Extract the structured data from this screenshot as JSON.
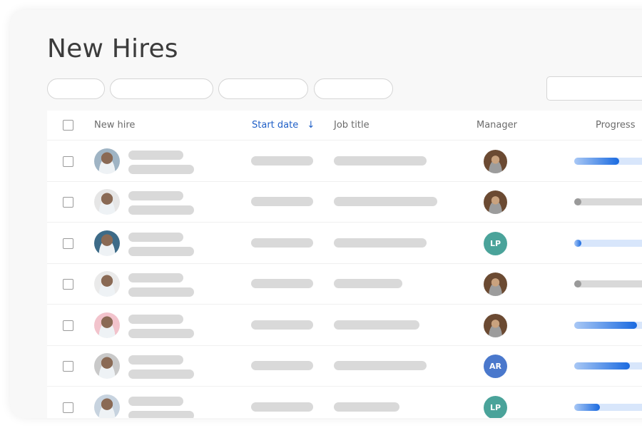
{
  "page": {
    "title": "New Hires"
  },
  "filters": {
    "chip_count": 4,
    "search_placeholder": ""
  },
  "table": {
    "columns": [
      {
        "key": "new_hire",
        "label": "New hire"
      },
      {
        "key": "start_date",
        "label": "Start date",
        "sorted": "desc",
        "sort_icon": "arrow-down-icon"
      },
      {
        "key": "job_title",
        "label": "Job title"
      },
      {
        "key": "manager",
        "label": "Manager"
      },
      {
        "key": "progress",
        "label": "Progress"
      }
    ],
    "rows": [
      {
        "avatar": "photo-man-light-shirt",
        "avatar_bg": "#9fb4c4",
        "manager": {
          "type": "photo",
          "initials": "",
          "color": "#6b4a32"
        },
        "progress": 0.45,
        "status": "active"
      },
      {
        "avatar": "photo-man-smiling",
        "avatar_bg": "#e6e6e6",
        "manager": {
          "type": "photo",
          "initials": "",
          "color": "#6b4a32"
        },
        "progress": 0,
        "status": "not-started"
      },
      {
        "avatar": "photo-woman-blue-bg",
        "avatar_bg": "#3d6b88",
        "manager": {
          "type": "initials",
          "initials": "LP",
          "color": "#4aa39a"
        },
        "progress": 0.03,
        "status": "active"
      },
      {
        "avatar": "photo-woman-dark-hair",
        "avatar_bg": "#eaeaea",
        "manager": {
          "type": "photo",
          "initials": "",
          "color": "#6b4a32"
        },
        "progress": 0,
        "status": "not-started"
      },
      {
        "avatar": "photo-woman-pink-bg",
        "avatar_bg": "#f2c3cc",
        "manager": {
          "type": "photo",
          "initials": "",
          "color": "#6b4a32"
        },
        "progress": 0.63,
        "status": "active"
      },
      {
        "avatar": "photo-man-beard",
        "avatar_bg": "#c9c9c9",
        "manager": {
          "type": "initials",
          "initials": "AR",
          "color": "#4a78cc"
        },
        "progress": 0.56,
        "status": "active"
      },
      {
        "avatar": "photo-woman-blonde",
        "avatar_bg": "#c7d3df",
        "manager": {
          "type": "initials",
          "initials": "LP",
          "color": "#4aa39a"
        },
        "progress": 0.26,
        "status": "active"
      }
    ]
  },
  "colors": {
    "accent": "#1f5fc7",
    "progress_fill": "#1a6ae0",
    "progress_track": "#d8e6fb",
    "inactive_track": "#d9d9d9",
    "inactive_dot": "#9a9a9a"
  }
}
